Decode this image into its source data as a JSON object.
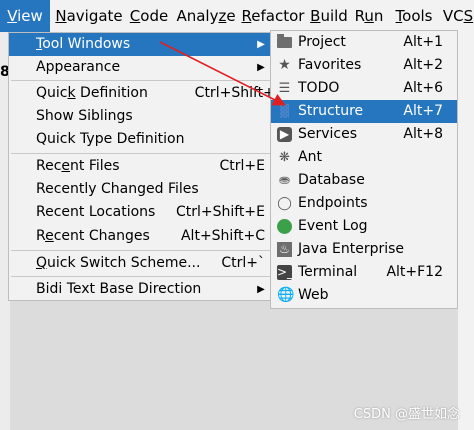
{
  "menubar": {
    "items": [
      {
        "pre": "",
        "mnem": "V",
        "post": "iew"
      },
      {
        "pre": "",
        "mnem": "N",
        "post": "avigate"
      },
      {
        "pre": "",
        "mnem": "C",
        "post": "ode"
      },
      {
        "pre": "Analy",
        "mnem": "z",
        "post": "e"
      },
      {
        "pre": "",
        "mnem": "R",
        "post": "efactor"
      },
      {
        "pre": "",
        "mnem": "B",
        "post": "uild"
      },
      {
        "pre": "R",
        "mnem": "u",
        "post": "n"
      },
      {
        "pre": "",
        "mnem": "T",
        "post": "ools"
      },
      {
        "pre": "VC",
        "mnem": "S",
        "post": ""
      }
    ]
  },
  "editor": {
    "line_number": "8"
  },
  "view_menu": {
    "items": [
      {
        "pre": "",
        "mnem": "T",
        "post": "ool Windows",
        "shortcut": "",
        "submenu": true,
        "selected": true
      },
      {
        "pre": "",
        "mnem": "",
        "post": "Appearance",
        "shortcut": "",
        "submenu": true
      },
      {
        "pre": "Quic",
        "mnem": "k",
        "post": " Definition",
        "shortcut": "Ctrl+Shift+I"
      },
      {
        "pre": "Show Siblings",
        "mnem": "",
        "post": "",
        "shortcut": ""
      },
      {
        "pre": "Quick Type Definition",
        "mnem": "",
        "post": "",
        "shortcut": ""
      },
      {
        "pre": "Rec",
        "mnem": "e",
        "post": "nt Files",
        "shortcut": "Ctrl+E"
      },
      {
        "pre": "Recently Changed Files",
        "mnem": "",
        "post": "",
        "shortcut": ""
      },
      {
        "pre": "Recent Locations",
        "mnem": "",
        "post": "",
        "shortcut": "Ctrl+Shift+E"
      },
      {
        "pre": "R",
        "mnem": "e",
        "post": "cent Changes",
        "shortcut": "Alt+Shift+C"
      },
      {
        "pre": "",
        "mnem": "Q",
        "post": "uick Switch Scheme...",
        "shortcut": "Ctrl+`"
      },
      {
        "pre": "Bidi Text Base Direction",
        "mnem": "",
        "post": "",
        "shortcut": "",
        "submenu": true
      }
    ]
  },
  "tool_windows_menu": {
    "items": [
      {
        "label": "Project",
        "shortcut": "Alt+1",
        "icon": "folder-icon"
      },
      {
        "label": "Favorites",
        "shortcut": "Alt+2",
        "icon": "star-icon"
      },
      {
        "label": "TODO",
        "shortcut": "Alt+6",
        "icon": "list-icon"
      },
      {
        "label": "Structure",
        "shortcut": "Alt+7",
        "icon": "structure-icon",
        "selected": true
      },
      {
        "label": "Services",
        "shortcut": "Alt+8",
        "icon": "services-icon"
      },
      {
        "label": "Ant",
        "shortcut": "",
        "icon": "ant-icon"
      },
      {
        "label": "Database",
        "shortcut": "",
        "icon": "database-icon"
      },
      {
        "label": "Endpoints",
        "shortcut": "",
        "icon": "endpoints-icon"
      },
      {
        "label": "Event Log",
        "shortcut": "",
        "icon": "event-log-icon"
      },
      {
        "label": "Java Enterprise",
        "shortcut": "",
        "icon": "java-enterprise-icon"
      },
      {
        "label": "Terminal",
        "shortcut": "Alt+F12",
        "icon": "terminal-icon"
      },
      {
        "label": "Web",
        "shortcut": "",
        "icon": "globe-icon"
      }
    ]
  },
  "watermark": "CSDN @盛世如念",
  "colors": {
    "accent": "#2675bf",
    "annotation_arrow": "#e02020"
  }
}
